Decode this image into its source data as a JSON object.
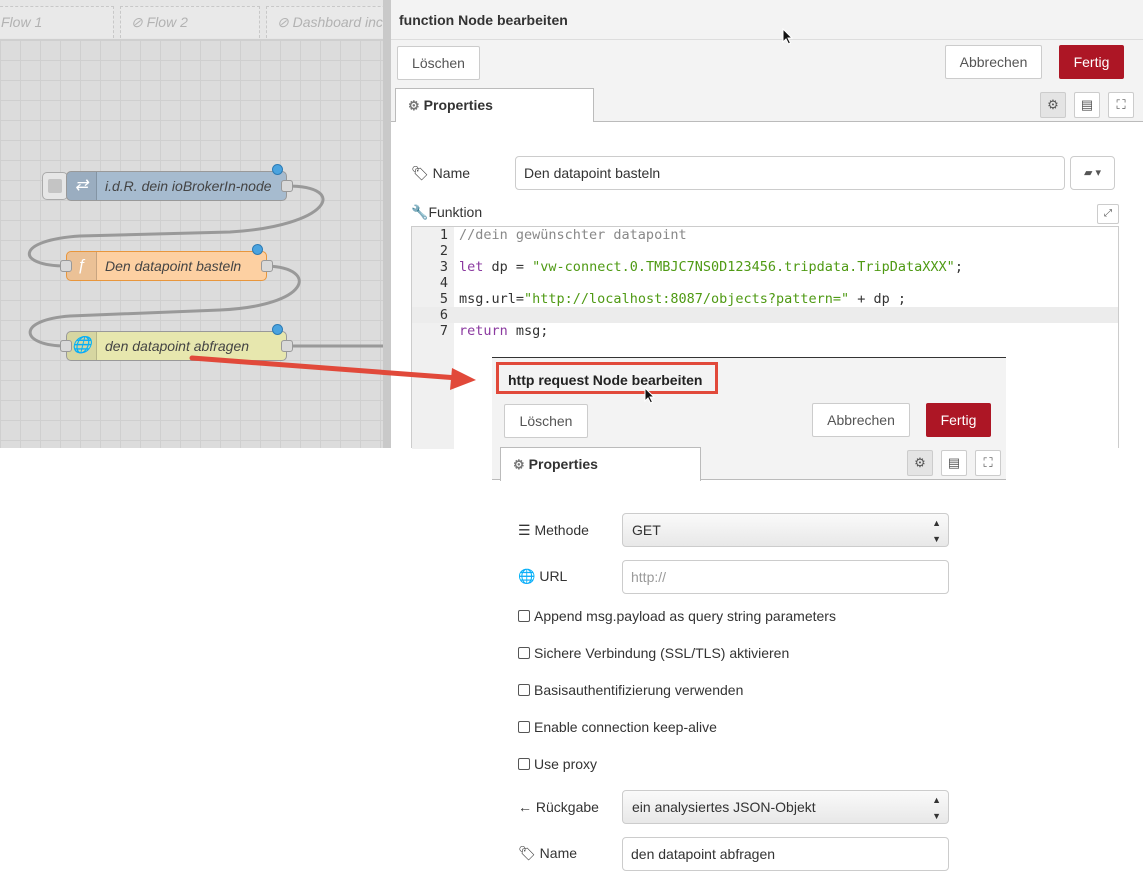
{
  "canvas": {
    "tabs": [
      {
        "label": "Flow 1",
        "icon": ""
      },
      {
        "label": "Flow 2",
        "icon": "⊘"
      },
      {
        "label": "Dashboard inc",
        "icon": "⊘"
      }
    ],
    "nodes": [
      {
        "label": "i.d.R. dein ioBrokerIn-node",
        "icon": "⇄",
        "color": "#a6bbcf"
      },
      {
        "label": "Den datapoint basteln",
        "icon": "ƒ",
        "color": "#fdd0a2"
      },
      {
        "label": "den datapoint abfragen",
        "icon": "🌐",
        "color": "#e7e7ae"
      }
    ]
  },
  "function_editor": {
    "title": "function Node bearbeiten",
    "delete_label": "Löschen",
    "cancel_label": "Abbrechen",
    "done_label": "Fertig",
    "tab_label": "Properties",
    "name_label": "Name",
    "name_value": "Den datapoint basteln",
    "function_label": "Funktion",
    "code": [
      {
        "num": "1",
        "text": "//dein gewünschter datapoint"
      },
      {
        "num": "2",
        "text": ""
      },
      {
        "num": "3",
        "kw": "let",
        "rest": " dp = ",
        "str": "\"vw-connect.0.TMBJC7NS0D123456.tripdata.TripDataXXX\"",
        "end": ";"
      },
      {
        "num": "4",
        "text": ""
      },
      {
        "num": "5",
        "pre": "msg.url=",
        "str": "\"http://localhost:8087/objects?pattern=\"",
        "end": " + dp ;"
      },
      {
        "num": "6",
        "text": ""
      },
      {
        "num": "7",
        "kw": "return",
        "rest": " msg;"
      }
    ]
  },
  "http_editor": {
    "title": "http request Node bearbeiten",
    "delete_label": "Löschen",
    "cancel_label": "Abbrechen",
    "done_label": "Fertig",
    "tab_label": "Properties",
    "method_label": "Methode",
    "method_value": "GET",
    "url_label": "URL",
    "url_placeholder": "http://",
    "checkboxes": [
      "Append msg.payload as query string parameters",
      "Sichere Verbindung (SSL/TLS) aktivieren",
      "Basisauthentifizierung verwenden",
      "Enable connection keep-alive",
      "Use proxy"
    ],
    "return_label": "Rückgabe",
    "return_value": "ein analysiertes JSON-Objekt",
    "name_label": "Name",
    "name_value": "den datapoint abfragen"
  },
  "colors": {
    "primary_button": "#ad1625",
    "annotation": "#e1493a",
    "port": "#4aa3df"
  }
}
